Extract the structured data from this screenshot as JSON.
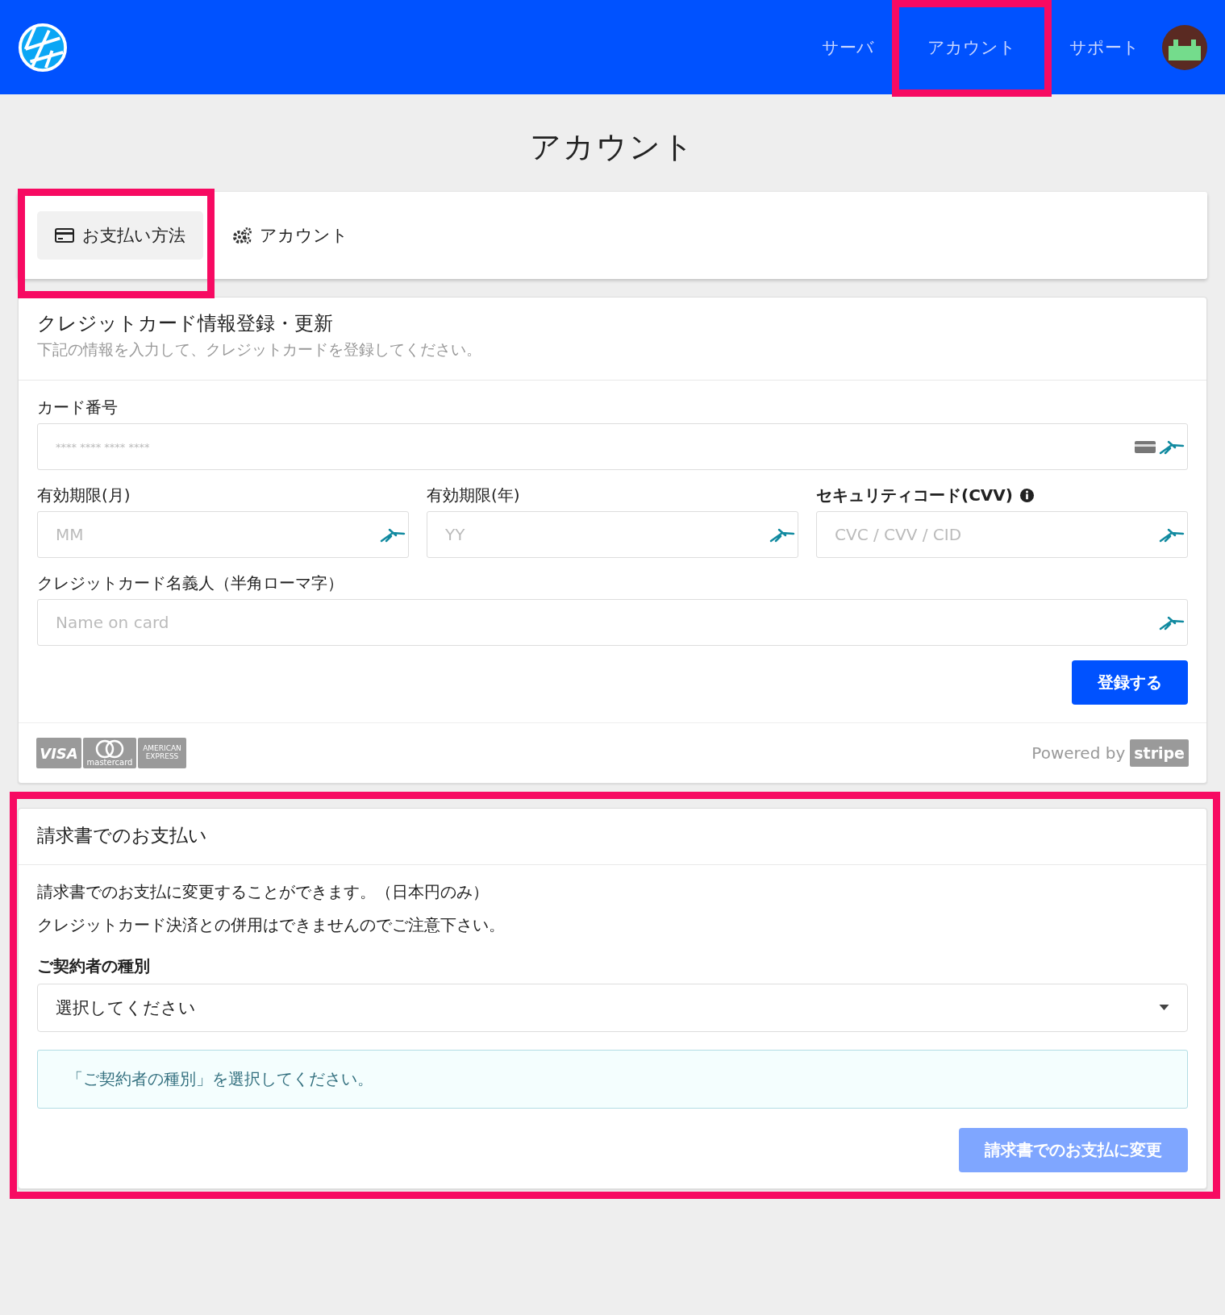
{
  "header": {
    "nav": [
      {
        "label": "サーバ",
        "highlighted": false
      },
      {
        "label": "アカウント",
        "highlighted": true
      },
      {
        "label": "サポート",
        "highlighted": false
      }
    ]
  },
  "page_title": "アカウント",
  "tabs": [
    {
      "label": "お支払い方法",
      "kind": "card",
      "selected": true,
      "highlighted": true
    },
    {
      "label": "アカウント",
      "kind": "gears",
      "selected": false,
      "highlighted": false
    }
  ],
  "card_form": {
    "title": "クレジットカード情報登録・更新",
    "subtitle": "下記の情報を入力して、クレジットカードを登録してください。",
    "field_rows": [
      [
        {
          "label": "カード番号",
          "placeholder": "**** **** **** ****",
          "strong": false,
          "info": false,
          "card_icon": true
        }
      ],
      [
        {
          "label": "有効期限(月)",
          "placeholder": "MM",
          "strong": false,
          "info": false,
          "card_icon": false
        },
        {
          "label": "有効期限(年)",
          "placeholder": "YY",
          "strong": false,
          "info": false,
          "card_icon": false
        },
        {
          "label": "セキュリティコード(CVV)",
          "placeholder": "CVC / CVV / CID",
          "strong": true,
          "info": true,
          "card_icon": false
        }
      ],
      [
        {
          "label": "クレジットカード名義人（半角ローマ字）",
          "placeholder": "Name on card",
          "strong": false,
          "info": false,
          "card_icon": false
        }
      ]
    ],
    "submit": "登録する",
    "brands": [
      {
        "kind": "visa",
        "text": "VISA"
      },
      {
        "kind": "mastercard",
        "text": "mastercard"
      },
      {
        "kind": "amex",
        "text": "AMERICAN EXPRESS"
      }
    ],
    "powered_by": "Powered by",
    "stripe": "stripe"
  },
  "invoice": {
    "highlighted": true,
    "title": "請求書でのお支払い",
    "lines": [
      "請求書でのお支払に変更することができます。（日本円のみ）",
      "クレジットカード決済との併用はできませんのでご注意下さい。"
    ],
    "field_label": "ご契約者の種別",
    "select_value": "選択してください",
    "notice": "「ご契約者の種別」を選択してください。",
    "button": {
      "label": "請求書でのお支払に変更",
      "disabled": true
    }
  }
}
